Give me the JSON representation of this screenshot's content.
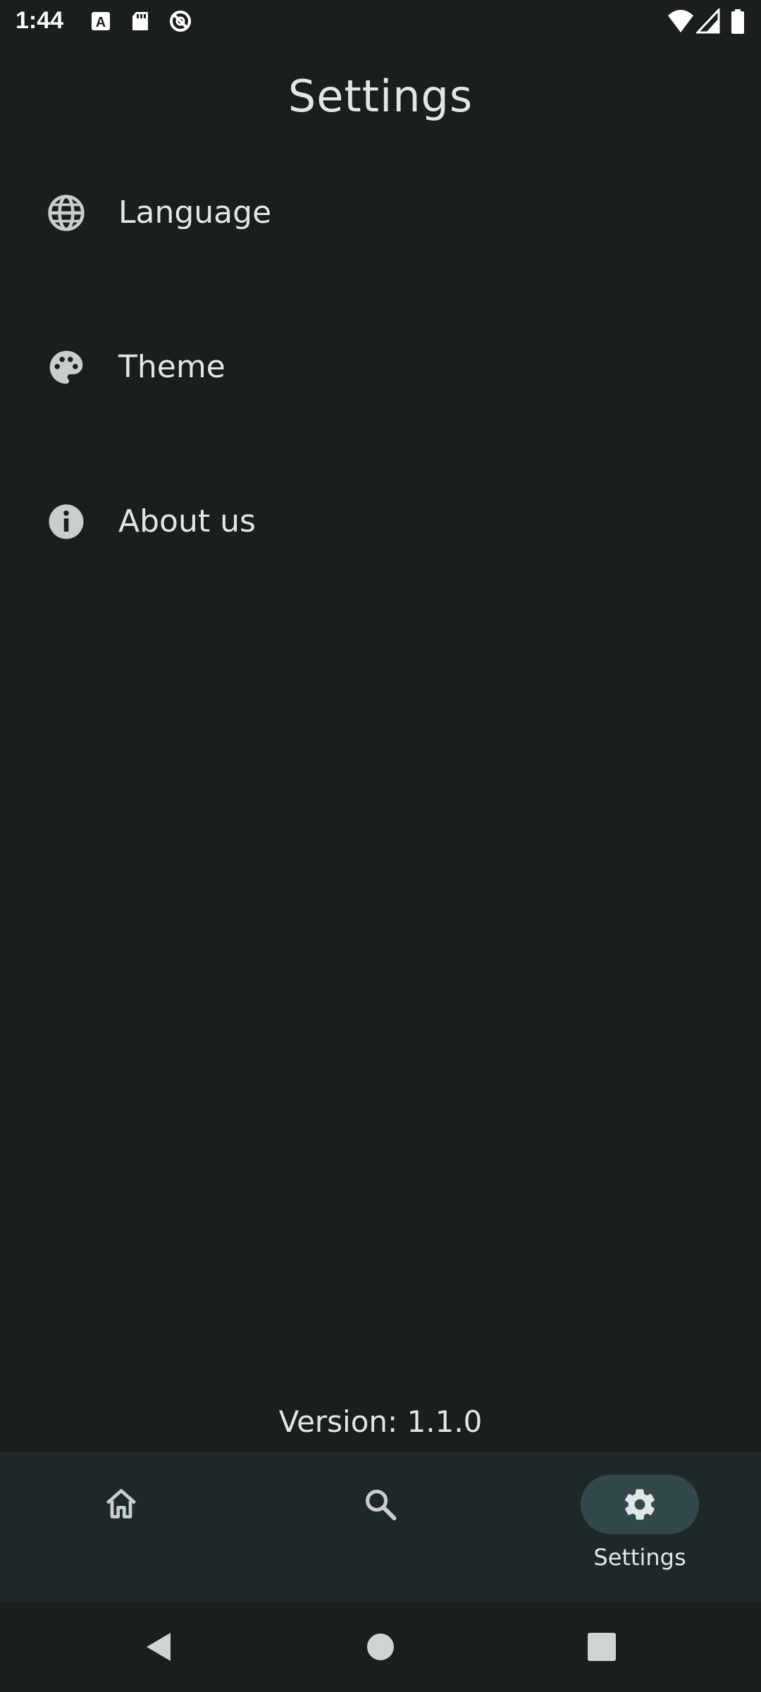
{
  "status_bar": {
    "time": "1:44",
    "left_icons": [
      "text-a-icon",
      "sd-card-icon",
      "no-disturb-icon"
    ],
    "right_icons": [
      "wifi-icon",
      "signal-icon",
      "battery-icon"
    ]
  },
  "header": {
    "title": "Settings"
  },
  "settings": {
    "items": [
      {
        "label": "Language",
        "icon": "globe-icon"
      },
      {
        "label": "Theme",
        "icon": "palette-icon"
      },
      {
        "label": "About us",
        "icon": "info-icon"
      }
    ]
  },
  "footer": {
    "version": "Version: 1.1.0"
  },
  "bottom_nav": {
    "items": [
      {
        "icon": "home-icon",
        "label": "",
        "active": false
      },
      {
        "icon": "search-icon",
        "label": "",
        "active": false
      },
      {
        "icon": "gear-icon",
        "label": "Settings",
        "active": true
      }
    ]
  },
  "system_nav": {
    "buttons": [
      "back-icon",
      "home-circle-icon",
      "recents-icon"
    ]
  },
  "colors": {
    "background": "#1a1e1f",
    "nav_background": "#1f2829",
    "active_pill": "#33484a",
    "text": "#e3e6e6",
    "icon": "#c9cdcd"
  }
}
